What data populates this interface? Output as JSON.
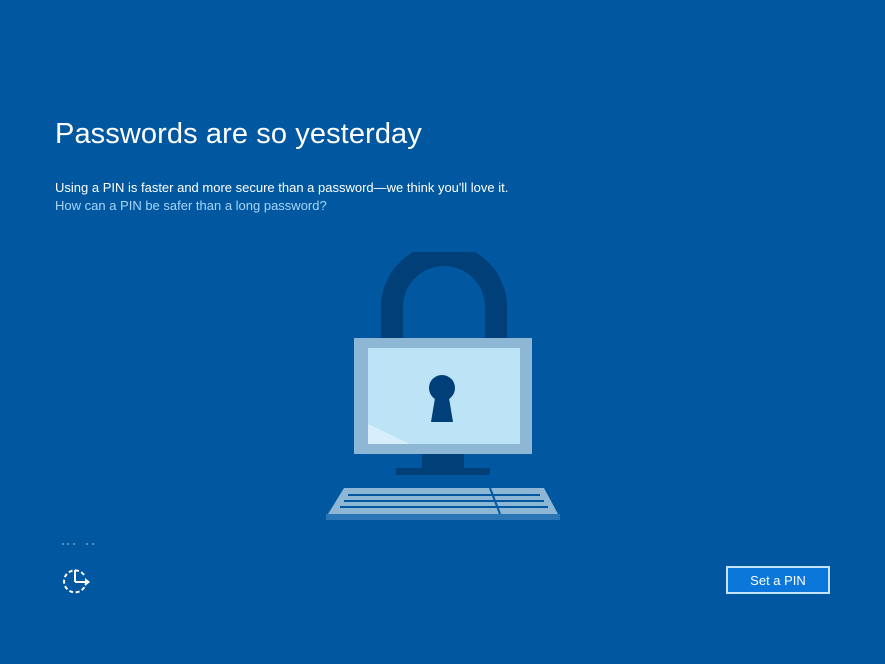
{
  "page": {
    "title": "Passwords are so yesterday",
    "description": "Using a PIN is faster and more secure than a password—we think you'll love it.",
    "learn_more_link": "How can a PIN be safer than a long password?"
  },
  "illustration": {
    "icon": "padlock-on-computer-icon"
  },
  "footer": {
    "ease_of_access_icon": "ease-of-access-icon",
    "primary_button_label": "Set a PIN"
  },
  "colors": {
    "background": "#0158a0",
    "link": "#a8d4fb",
    "button_fill": "#0b77da",
    "button_border": "#c7e3fb",
    "lock_dark": "#003f77",
    "monitor_frame": "#8eb6d5",
    "screen_fill": "#bde3f6",
    "keyboard": "#8eb6d5"
  }
}
